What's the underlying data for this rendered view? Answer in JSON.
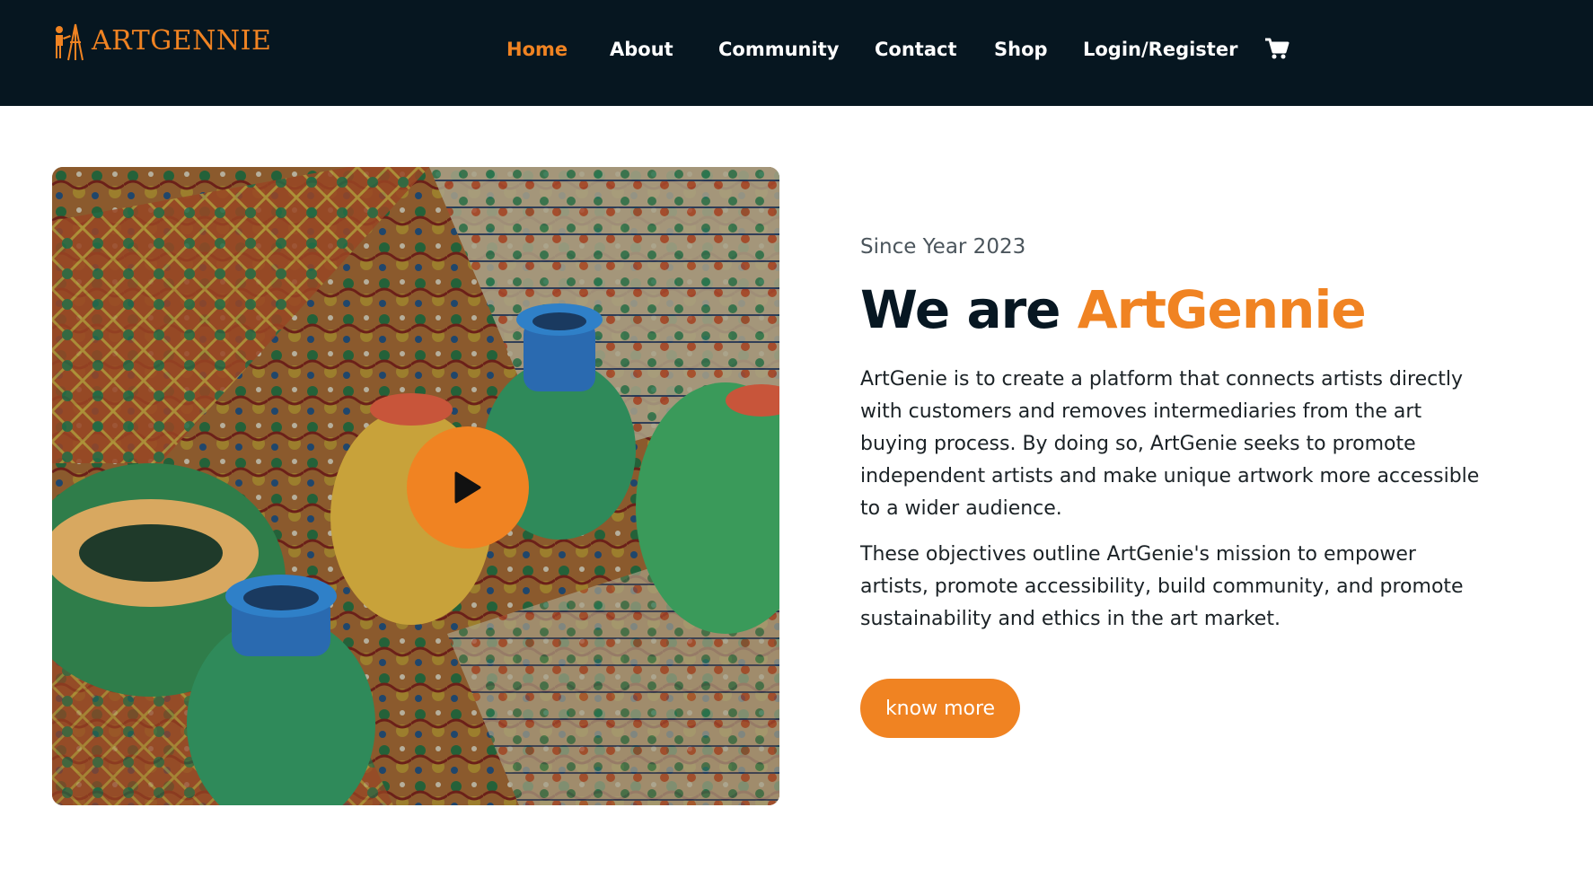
{
  "brand": {
    "name": "ARTGENNIE",
    "color": "#f08322"
  },
  "nav": {
    "items": [
      {
        "label": "Home",
        "active": true
      },
      {
        "label": "About",
        "active": false
      },
      {
        "label": "Community",
        "active": false
      },
      {
        "label": "Contact",
        "active": false
      },
      {
        "label": "Shop",
        "active": false
      },
      {
        "label": "Login/Register",
        "active": false
      }
    ],
    "cart_icon": "shopping-cart-icon"
  },
  "hero": {
    "media_icon": "play-icon",
    "eyebrow": "Since Year 2023",
    "headline_prefix": "We are ",
    "headline_accent": "ArtGennie",
    "paragraphs": [
      "ArtGenie is to create a platform that connects artists directly with customers and removes intermediaries from the art buying process. By doing so, ArtGenie seeks to promote independent artists and make unique artwork more accessible to a wider audience.",
      "These objectives outline ArtGenie's mission to empower artists, promote accessibility, build community, and promote sustainability and ethics in the art market."
    ],
    "cta_label": "know more"
  },
  "colors": {
    "header_bg": "#061620",
    "accent": "#f08322",
    "heading": "#071722"
  }
}
